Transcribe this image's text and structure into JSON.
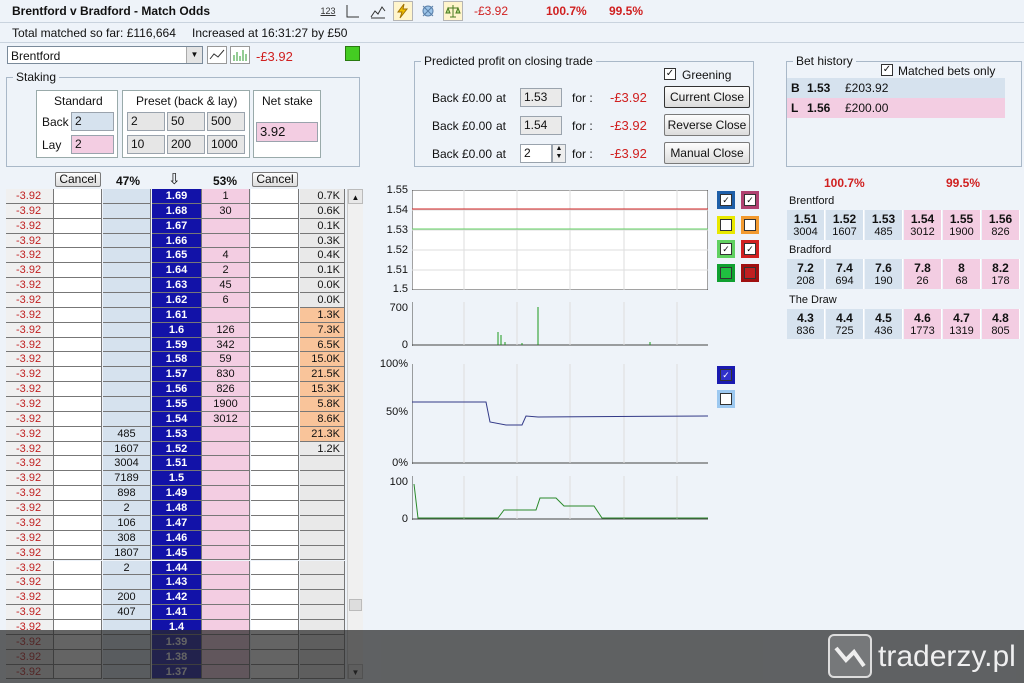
{
  "header": {
    "title": "Brentford v Bradford - Match Odds",
    "toolbar_icon_123": "123",
    "pl": "-£3.92",
    "pct_back": "100.7%",
    "pct_lay": "99.5%"
  },
  "info": {
    "total_matched": "Total matched so far: £116,664",
    "increased": "Increased at 16:31:27 by £50"
  },
  "selection": {
    "value": "Brentford",
    "pl": "-£3.92"
  },
  "staking": {
    "title": "Staking",
    "standard": "Standard",
    "back_label": "Back",
    "lay_label": "Lay",
    "back_val": "2",
    "lay_val": "2",
    "preset_title": "Preset (back & lay)",
    "preset_back": [
      "2",
      "50",
      "500"
    ],
    "preset_lay": [
      "10",
      "200",
      "1000"
    ],
    "net_title": "Net stake",
    "net_val": "3.92"
  },
  "predicted": {
    "title": "Predicted profit on closing trade",
    "greening": "Greening",
    "rows": [
      {
        "back": "Back",
        "amount": "£0.00",
        "at": "at",
        "price": "1.53",
        "for": "for :",
        "pl": "-£3.92"
      },
      {
        "back": "Back",
        "amount": "£0.00",
        "at": "at",
        "price": "1.54",
        "for": "for :",
        "pl": "-£3.92"
      },
      {
        "back": "Back",
        "amount": "£0.00",
        "at": "at",
        "price": "2",
        "for": "for :",
        "pl": "-£3.92"
      }
    ],
    "buttons": [
      "Current Close",
      "Reverse Close",
      "Manual Close"
    ]
  },
  "bet_history": {
    "title": "Bet history",
    "matched_only": "Matched bets only",
    "bets": [
      {
        "type": "B",
        "price": "1.53",
        "amount": "£203.92"
      },
      {
        "type": "L",
        "price": "1.56",
        "amount": "£200.00"
      }
    ]
  },
  "ladder": {
    "cancel": "Cancel",
    "back_pct": "47%",
    "lay_pct": "53%",
    "arrow": "⇩",
    "pl": "-3.92",
    "rows": [
      {
        "p": "1.69",
        "l": "1",
        "v": "0.7K"
      },
      {
        "p": "1.68",
        "l": "30",
        "v": "0.6K"
      },
      {
        "p": "1.67",
        "l": "",
        "v": "0.1K"
      },
      {
        "p": "1.66",
        "l": "",
        "v": "0.3K"
      },
      {
        "p": "1.65",
        "l": "4",
        "v": "0.4K"
      },
      {
        "p": "1.64",
        "l": "2",
        "v": "0.1K"
      },
      {
        "p": "1.63",
        "l": "45",
        "v": "0.0K"
      },
      {
        "p": "1.62",
        "l": "6",
        "v": "0.0K"
      },
      {
        "p": "1.61",
        "l": "",
        "v": "1.3K",
        "hot": true
      },
      {
        "p": "1.6",
        "l": "126",
        "v": "7.3K",
        "hot": true
      },
      {
        "p": "1.59",
        "l": "342",
        "v": "6.5K",
        "hot": true
      },
      {
        "p": "1.58",
        "l": "59",
        "v": "15.0K",
        "hot": true
      },
      {
        "p": "1.57",
        "l": "830",
        "v": "21.5K",
        "hot": true
      },
      {
        "p": "1.56",
        "l": "826",
        "v": "15.3K",
        "hot": true
      },
      {
        "p": "1.55",
        "l": "1900",
        "v": "5.8K",
        "hot": true
      },
      {
        "p": "1.54",
        "l": "3012",
        "v": "8.6K",
        "hot": true
      },
      {
        "p": "1.53",
        "b": "485",
        "v": "21.3K",
        "hot": true
      },
      {
        "p": "1.52",
        "b": "1607",
        "v": "1.2K"
      },
      {
        "p": "1.51",
        "b": "3004"
      },
      {
        "p": "1.5",
        "b": "7189"
      },
      {
        "p": "1.49",
        "b": "898"
      },
      {
        "p": "1.48",
        "b": "2"
      },
      {
        "p": "1.47",
        "b": "106"
      },
      {
        "p": "1.46",
        "b": "308"
      },
      {
        "p": "1.45",
        "b": "1807"
      },
      {
        "p": "1.44",
        "b": "2"
      },
      {
        "p": "1.43",
        "b": ""
      },
      {
        "p": "1.42",
        "b": "200"
      },
      {
        "p": "1.41",
        "b": "407"
      },
      {
        "p": "1.4",
        "b": ""
      },
      {
        "p": "1.39",
        "b": ""
      },
      {
        "p": "1.38",
        "b": ""
      },
      {
        "p": "1.37",
        "b": ""
      }
    ]
  },
  "charts": {
    "price_axis": [
      "1.55",
      "1.54",
      "1.53",
      "1.52",
      "1.51",
      "1.5"
    ],
    "vol_axis": [
      "700",
      "0"
    ],
    "pct_axis": [
      "100%",
      "50%",
      "0%"
    ],
    "bot_axis": [
      "100",
      "0"
    ]
  },
  "market": {
    "pct_back": "100.7%",
    "pct_lay": "99.5%",
    "runners": [
      {
        "name": "Brentford",
        "odds": [
          [
            "1.51",
            "3004"
          ],
          [
            "1.52",
            "1607"
          ],
          [
            "1.53",
            "485"
          ],
          [
            "1.54",
            "3012"
          ],
          [
            "1.55",
            "1900"
          ],
          [
            "1.56",
            "826"
          ]
        ]
      },
      {
        "name": "Bradford",
        "odds": [
          [
            "7.2",
            "208"
          ],
          [
            "7.4",
            "694"
          ],
          [
            "7.6",
            "190"
          ],
          [
            "7.8",
            "26"
          ],
          [
            "8",
            "68"
          ],
          [
            "8.2",
            "178"
          ]
        ]
      },
      {
        "name": "The Draw",
        "odds": [
          [
            "4.3",
            "836"
          ],
          [
            "4.4",
            "725"
          ],
          [
            "4.5",
            "436"
          ],
          [
            "4.6",
            "1773"
          ],
          [
            "4.7",
            "1319"
          ],
          [
            "4.8",
            "805"
          ]
        ]
      }
    ]
  },
  "watermark": "traderzy.pl",
  "colors": {
    "back": "#d6e2ee",
    "lay": "#f3cde2",
    "price": "#1212a8",
    "hot": "#f9c49a",
    "pl_red": "#d02020"
  }
}
